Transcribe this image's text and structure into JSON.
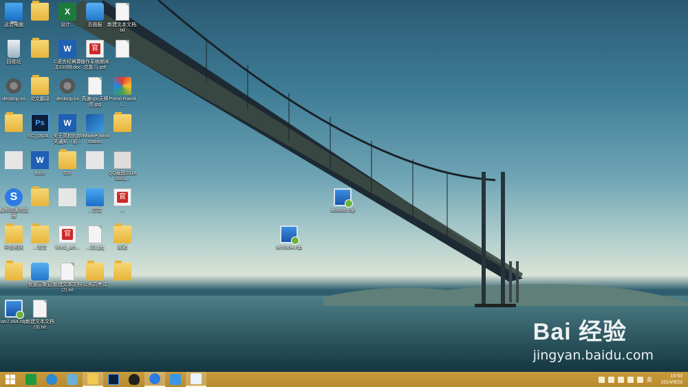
{
  "desktop": {
    "icons": [
      {
        "label": "这台电脑",
        "kind": "pc"
      },
      {
        "label": "",
        "kind": "folder"
      },
      {
        "label": "设计...",
        "kind": "excel"
      },
      {
        "label": "页面报",
        "kind": "note"
      },
      {
        "label": "新建文本文档.txt",
        "kind": "doc"
      },
      {
        "label": "回收站",
        "kind": "bin"
      },
      {
        "label": "",
        "kind": "folder"
      },
      {
        "label": "C语言经典算法100例.doc",
        "kind": "word"
      },
      {
        "label": "操作系统期末总复习.pdf",
        "kind": "pdf"
      },
      {
        "label": "",
        "kind": "doc"
      },
      {
        "label": "desktop.ini",
        "kind": "gear"
      },
      {
        "label": "论文翻译",
        "kind": "folder"
      },
      {
        "label": "desktop.ini",
        "kind": "gear"
      },
      {
        "label": "高速cpu天棒图.jpg",
        "kind": "doc"
      },
      {
        "label": "Primo Ramdi...",
        "kind": "primo"
      },
      {
        "label": "",
        "kind": "folder"
      },
      {
        "label": "SC_1824...",
        "kind": "ps"
      },
      {
        "label": "关于高校的相关通知（初...",
        "kind": "word"
      },
      {
        "label": "VMware Workstation",
        "kind": "vmware"
      },
      {
        "label": "",
        "kind": "folder"
      },
      {
        "label": "",
        "kind": "sketch"
      },
      {
        "label": "docx",
        "kind": "word"
      },
      {
        "label": "SIX",
        "kind": "folder"
      },
      {
        "label": "",
        "kind": "sketch"
      },
      {
        "label": "QQ截图20140901...",
        "kind": "qq"
      },
      {
        "label": "搜狗高速浏览器",
        "kind": "sogou"
      },
      {
        "label": "",
        "kind": "folder"
      },
      {
        "label": "",
        "kind": "sketch"
      },
      {
        "label": "...方式",
        "kind": "pc"
      },
      {
        "label": "...",
        "kind": "pdf"
      },
      {
        "label": "毕设相关",
        "kind": "folder"
      },
      {
        "label": "...论文",
        "kind": "folder"
      },
      {
        "label": "Word_am...",
        "kind": "pdf"
      },
      {
        "label": "...(2).jpg",
        "kind": "doc"
      },
      {
        "label": "邮箱",
        "kind": "folder"
      },
      {
        "label": "",
        "kind": "folder"
      },
      {
        "label": "有道云笔记",
        "kind": "note"
      },
      {
        "label": "新建文本文档(2).txt",
        "kind": "doc"
      },
      {
        "label": "公务员考试",
        "kind": "folder"
      },
      {
        "label": "",
        "kind": "folder"
      },
      {
        "label": "ws7.x64.rdp",
        "kind": "rdp"
      },
      {
        "label": "新建文本文档(3).txt",
        "kind": "doc"
      }
    ],
    "floating": [
      {
        "label": "ws8x86.rdp",
        "kind": "rdp"
      },
      {
        "label": "win8x64.rdp",
        "kind": "rdp"
      }
    ]
  },
  "watermark": {
    "main": "Bai 经验",
    "sub": "jingyan.baidu.com"
  },
  "taskbar": {
    "apps": [
      {
        "name": "start",
        "active": false
      },
      {
        "name": "store",
        "active": false
      },
      {
        "name": "ie",
        "active": false
      },
      {
        "name": "media",
        "active": false
      },
      {
        "name": "explorer",
        "active": true
      },
      {
        "name": "photoshop",
        "active": false
      },
      {
        "name": "qq",
        "active": false
      },
      {
        "name": "sogou",
        "active": true
      },
      {
        "name": "youdao",
        "active": false
      },
      {
        "name": "chat",
        "active": true
      }
    ],
    "tray": {
      "ime": "英",
      "time": "15:53",
      "date": "2014/9/23"
    }
  }
}
